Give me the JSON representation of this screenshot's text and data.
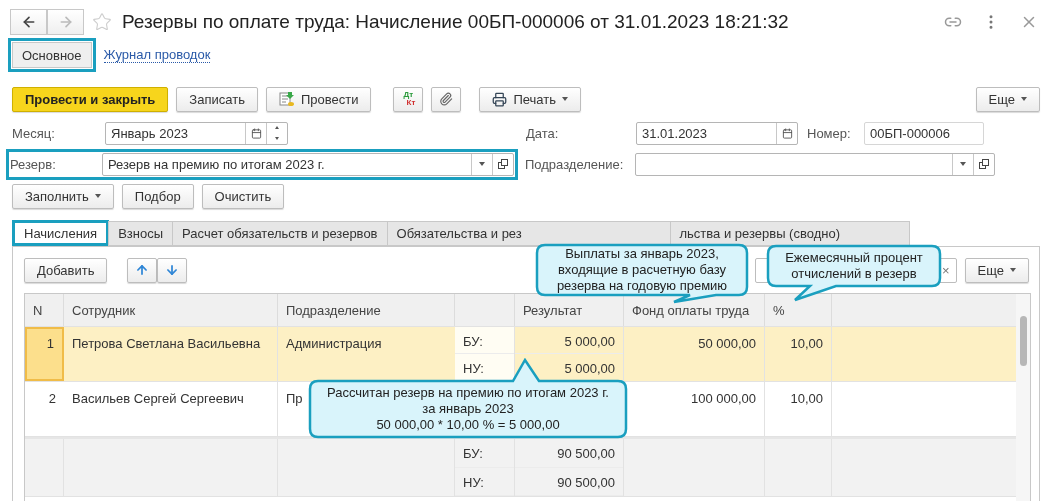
{
  "window": {
    "title": "Резервы по оплате труда: Начисление 00БП-000006 от 31.01.2023 18:21:32",
    "favorite": false
  },
  "sections": [
    {
      "label": "Основное",
      "selected": true,
      "highlighted": true
    },
    {
      "label": "Журнал проводок",
      "selected": false,
      "highlighted": false
    }
  ],
  "toolbar": {
    "buttons": [
      {
        "kind": "primary",
        "label": "Провести и закрыть"
      },
      {
        "kind": "plain",
        "label": "Записать"
      },
      {
        "kind": "post",
        "label": "Провести"
      },
      {
        "kind": "dtkt",
        "dt": "Дт",
        "kt": "Кт"
      },
      {
        "kind": "attach"
      },
      {
        "kind": "print",
        "label": "Печать"
      }
    ],
    "more": "Еще"
  },
  "month": {
    "label": "Месяц:",
    "value": "Январь 2023"
  },
  "date": {
    "label": "Дата:",
    "value": "31.01.2023"
  },
  "number": {
    "label": "Номер:",
    "value": "00БП-000006"
  },
  "reserve": {
    "label": "Резерв:",
    "value": "Резерв на премию по итогам 2023 г.",
    "highlighted": true
  },
  "department": {
    "label": "Подразделение:"
  },
  "fill_buttons": [
    {
      "label": "Заполнить",
      "dropdown": true
    },
    {
      "label": "Подбор",
      "dropdown": false
    },
    {
      "label": "Очистить",
      "dropdown": false
    }
  ],
  "tabs": [
    {
      "label": "Начисления",
      "selected": true,
      "highlighted": true
    },
    {
      "label": "Взносы",
      "selected": false,
      "highlighted": false
    },
    {
      "label": "Расчет обязательств и резервов",
      "selected": false,
      "highlighted": false
    },
    {
      "label": "Обязательства и рез",
      "selected": false,
      "highlighted": false
    },
    {
      "label": "льства и резервы (сводно)",
      "selected": false,
      "highlighted": false
    }
  ],
  "table_toolbar": {
    "add": "Добавить",
    "clear": "×",
    "more": "Еще"
  },
  "table": {
    "columns": [
      "N",
      "Сотрудник",
      "Подразделение",
      "Результат",
      "Фонд оплаты труда",
      "%"
    ],
    "rows": [
      {
        "n": "1",
        "employee": "Петрова Светлана Васильевна",
        "department": "Администрация",
        "bu_label": "БУ:",
        "nu_label": "НУ:",
        "result_bu": "5 000,00",
        "result_nu": "5 000,00",
        "fund": "50 000,00",
        "percent": "10,00",
        "selected": true
      },
      {
        "n": "2",
        "employee": "Васильев Сергей Сергеевич",
        "department": "Пр",
        "fund": "100 000,00",
        "percent": "10,00",
        "selected": false
      }
    ],
    "totals": {
      "bu_label": "БУ:",
      "nu_label": "НУ:",
      "result_bu": "90 500,00",
      "result_nu": "90 500,00"
    }
  },
  "callouts": [
    {
      "lines": [
        "Выплаты за январь 2023,",
        "входящие в расчетную базу",
        "резерва на годовую премию"
      ]
    },
    {
      "lines": [
        "Ежемесячный процент",
        "отчислений в резерв"
      ]
    },
    {
      "lines": [
        "Рассчитан резерв на премию по итогам 2023 г.",
        "за январь 2023",
        "50 000,00 * 10,00 % = 5 000,00"
      ]
    }
  ]
}
